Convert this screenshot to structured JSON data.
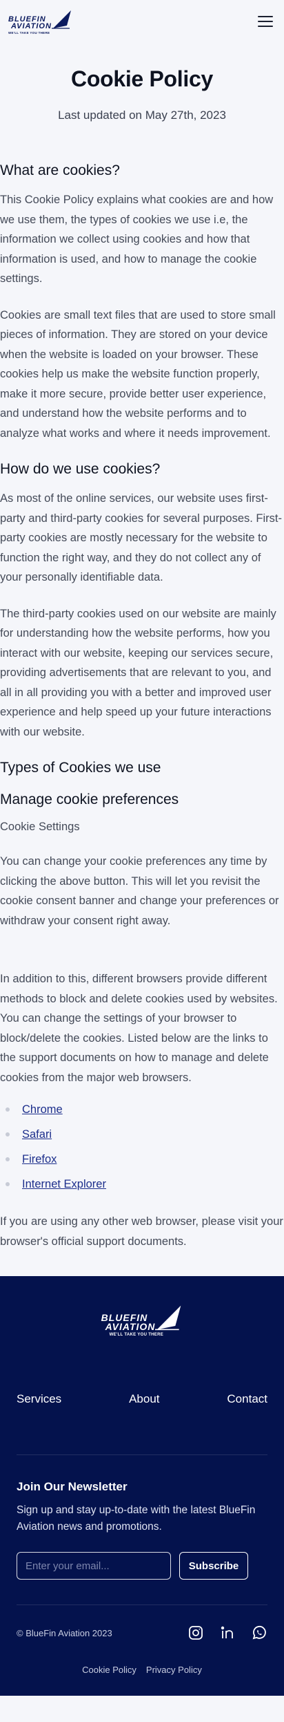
{
  "header": {
    "logo_text_1": "BLUEFIN",
    "logo_text_2": "AVIATION",
    "logo_tagline": "WE'LL TAKE YOU THERE",
    "menu_icon": "hamburger-menu-icon"
  },
  "page": {
    "title": "Cookie Policy",
    "updated": "Last updated on May 27th, 2023"
  },
  "sections": {
    "what": {
      "heading": "What are cookies?",
      "p1": "This Cookie Policy explains what cookies are and how we use them, the types of cookies we use i.e, the information we collect using cookies and how that information is used, and how to manage the cookie settings.",
      "p2": "Cookies are small text files that are used to store small pieces of information. They are stored on your device when the website is loaded on your browser. These cookies help us make the website function properly, make it more secure, provide better user experience, and understand how the website performs and to analyze what works and where it needs improvement."
    },
    "how": {
      "heading": "How do we use cookies?",
      "p1": "As most of the online services, our website uses first-party and third-party cookies for several purposes. First-party cookies are mostly necessary for the website to function the right way, and they do not collect any of your personally identifiable data.",
      "p2": "The third-party cookies used on our website are mainly for understanding how the website performs, how you interact with our website, keeping our services secure, providing advertisements that are relevant to you, and all in all providing you with a better and improved user experience and help speed up your future interactions with our website."
    },
    "types": {
      "heading": "Types of Cookies we use"
    },
    "manage": {
      "heading": "Manage cookie preferences",
      "settings_label": "Cookie Settings",
      "p1": "You can change your cookie preferences any time by clicking the above button. This will let you revisit the cookie consent banner and change your preferences or withdraw your consent right away.",
      "p2": "In addition to this, different browsers provide different methods to block and delete cookies used by websites. You can change the settings of your browser to block/delete the cookies. Listed below are the links to the support documents on how to manage and delete cookies from the major web browsers.",
      "links": [
        "Chrome",
        "Safari",
        "Firefox",
        "Internet Explorer"
      ],
      "p3": "If you are using any other web browser, please visit your browser's official support documents."
    }
  },
  "footer": {
    "logo_text_1": "BLUEFIN",
    "logo_text_2": "AVIATION",
    "logo_tagline": "WE'LL TAKE YOU THERE",
    "nav": [
      "Services",
      "About",
      "Contact"
    ],
    "newsletter_title": "Join Our Newsletter",
    "newsletter_text": "Sign up and stay up-to-date with the latest BlueFin Aviation news and promotions.",
    "email_placeholder": "Enter your email...",
    "subscribe_label": "Subscribe",
    "copyright": "© BlueFin Aviation 2023",
    "socials": [
      "instagram-icon",
      "linkedin-icon",
      "whatsapp-icon"
    ],
    "legal": [
      "Cookie Policy",
      "Privacy Policy"
    ]
  },
  "colors": {
    "brand_navy": "#04124d",
    "link_blue": "#1d2f8c",
    "background": "#f5f6fa"
  }
}
